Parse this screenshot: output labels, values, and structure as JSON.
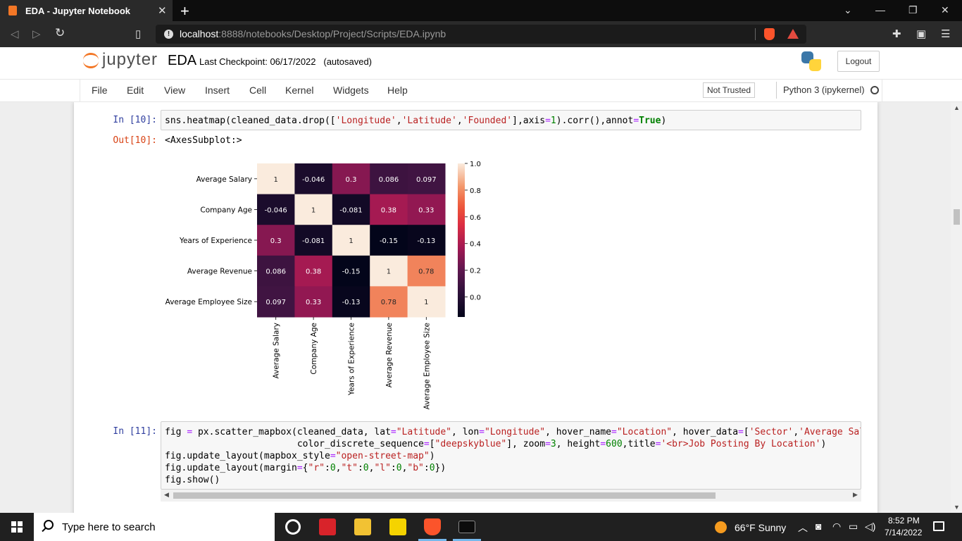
{
  "browser": {
    "tab_title": "EDA - Jupyter Notebook",
    "tab_close": "✕",
    "new_tab": "+",
    "url_host": "localhost",
    "url_path": ":8888/notebooks/Desktop/Project/Scripts/EDA.ipynb",
    "min": "—",
    "restore": "❐",
    "close": "✕",
    "chevron": "⌄"
  },
  "jupyter": {
    "logo_text": "jupyter",
    "notebook_name": "EDA",
    "checkpoint": "Last Checkpoint: 06/17/2022",
    "autosaved": "(autosaved)",
    "logout": "Logout",
    "menu": [
      "File",
      "Edit",
      "View",
      "Insert",
      "Cell",
      "Kernel",
      "Widgets",
      "Help"
    ],
    "trust": "Not Trusted",
    "kernel": "Python 3 (ipykernel)"
  },
  "cells": {
    "c10_in": "In [10]:",
    "c10_out": "Out[10]:",
    "c10_result": "<AxesSubplot:>",
    "c11_in": "In [11]:"
  },
  "chart_data": {
    "type": "heatmap",
    "labels": [
      "Average Salary",
      "Company Age",
      "Years of Experience",
      "Average Revenue",
      "Average Employee Size"
    ],
    "matrix": [
      [
        1,
        -0.046,
        0.3,
        0.086,
        0.097
      ],
      [
        -0.046,
        1,
        -0.081,
        0.38,
        0.33
      ],
      [
        0.3,
        -0.081,
        1,
        -0.15,
        -0.13
      ],
      [
        0.086,
        0.38,
        -0.15,
        1,
        0.78
      ],
      [
        0.097,
        0.33,
        -0.13,
        0.78,
        1
      ]
    ],
    "annotations": [
      [
        "1",
        "-0.046",
        "0.3",
        "0.086",
        "0.097"
      ],
      [
        "-0.046",
        "1",
        "-0.081",
        "0.38",
        "0.33"
      ],
      [
        "0.3",
        "-0.081",
        "1",
        "-0.15",
        "-0.13"
      ],
      [
        "0.086",
        "0.38",
        "-0.15",
        "1",
        "0.78"
      ],
      [
        "0.097",
        "0.33",
        "-0.13",
        "0.78",
        "1"
      ]
    ],
    "vmin": -0.15,
    "vmax": 1.0,
    "colorbar_ticks": [
      {
        "v": 1.0,
        "label": "1.0"
      },
      {
        "v": 0.8,
        "label": "0.8"
      },
      {
        "v": 0.6,
        "label": "0.6"
      },
      {
        "v": 0.4,
        "label": "0.4"
      },
      {
        "v": 0.2,
        "label": "0.2"
      },
      {
        "v": 0.0,
        "label": "0.0"
      }
    ],
    "colormap": "rocket"
  },
  "taskbar": {
    "search_placeholder": "Type here to search",
    "weather": "66°F  Sunny",
    "time": "8:52 PM",
    "date": "7/14/2022"
  }
}
